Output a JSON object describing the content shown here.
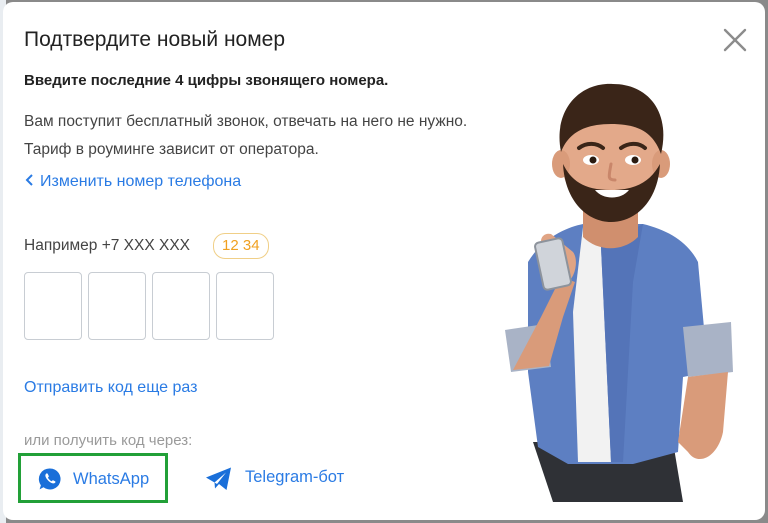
{
  "dialog": {
    "title": "Подтвердите новый номер",
    "subtitle": "Введите последние 4 цифры звонящего номера.",
    "description": "Вам поступит бесплатный звонок, отвечать на него не нужно. Тариф в роуминге зависит от оператора.",
    "change_number_link": "Изменить номер телефона",
    "example_text": "Например +7 XXX XXX",
    "example_digits": "12 34",
    "code_inputs": [
      "",
      "",
      "",
      ""
    ],
    "resend_link": "Отправить код еще раз",
    "alternative_label": "или получить код через:",
    "alternatives": {
      "whatsapp": "WhatsApp",
      "telegram": "Telegram-бот"
    }
  },
  "icons": {
    "close": "close-icon",
    "back": "chevron-left-icon",
    "whatsapp": "whatsapp-icon",
    "telegram": "telegram-icon"
  },
  "colors": {
    "link": "#2a7be4",
    "highlight": "#22a038",
    "badge": "#f0a020"
  }
}
